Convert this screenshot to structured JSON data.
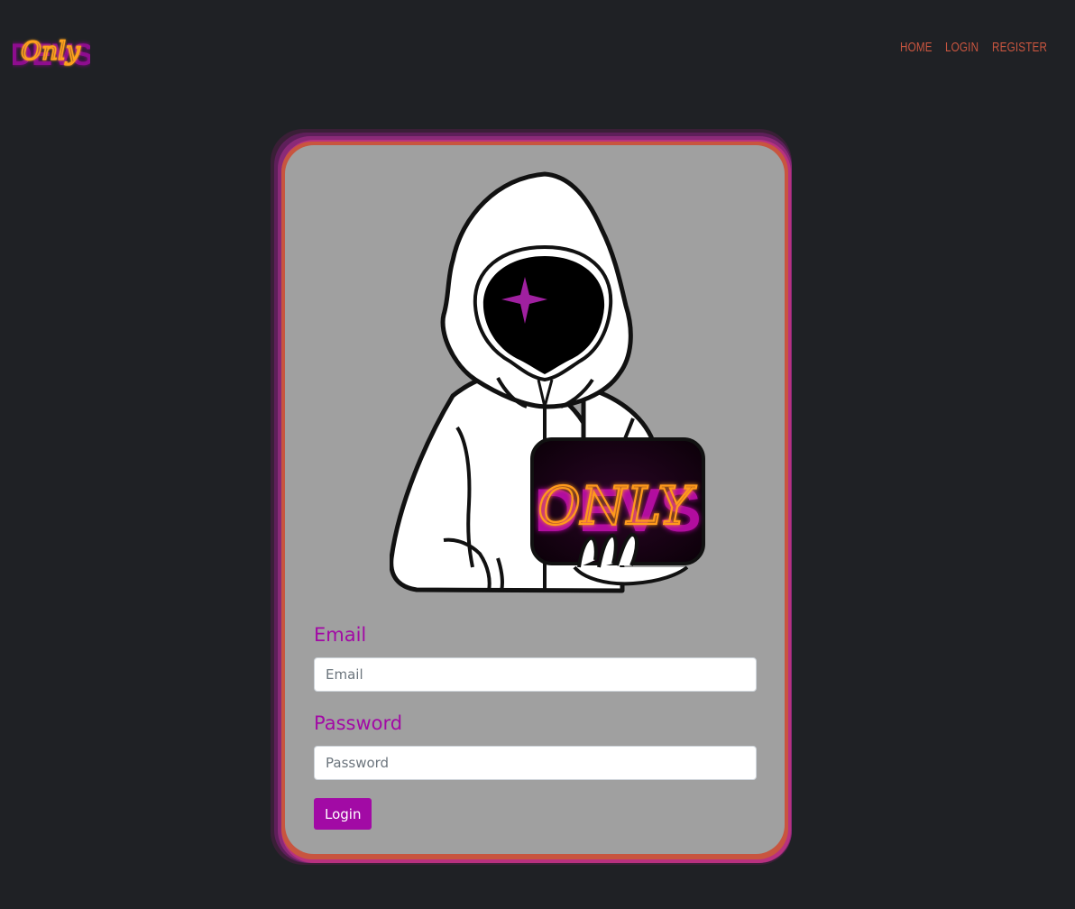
{
  "header": {
    "logo": {
      "text_back": "DEVS",
      "text_front": "Only",
      "icon": "only-devs-logo"
    },
    "nav": [
      {
        "label": "Home",
        "color": "#c8553f"
      },
      {
        "label": "Login",
        "color": "#c8553f"
      },
      {
        "label": "Register",
        "color": "#c8553f"
      }
    ]
  },
  "card": {
    "illustration": {
      "icon": "hooded-developer-illustration",
      "sign_text_back": "DEVS",
      "sign_text_front": "ONLY"
    },
    "form": {
      "email_label": "Email",
      "email_placeholder": "Email",
      "email_value": "",
      "password_label": "Password",
      "password_placeholder": "Password",
      "password_value": "",
      "submit_label": "Login"
    }
  },
  "colors": {
    "background": "#1f2125",
    "accent": "#a20aa5",
    "card_border": "#c8553f",
    "card_fill": "#a0a0a0",
    "neon_orange": "#ff9a1a"
  }
}
